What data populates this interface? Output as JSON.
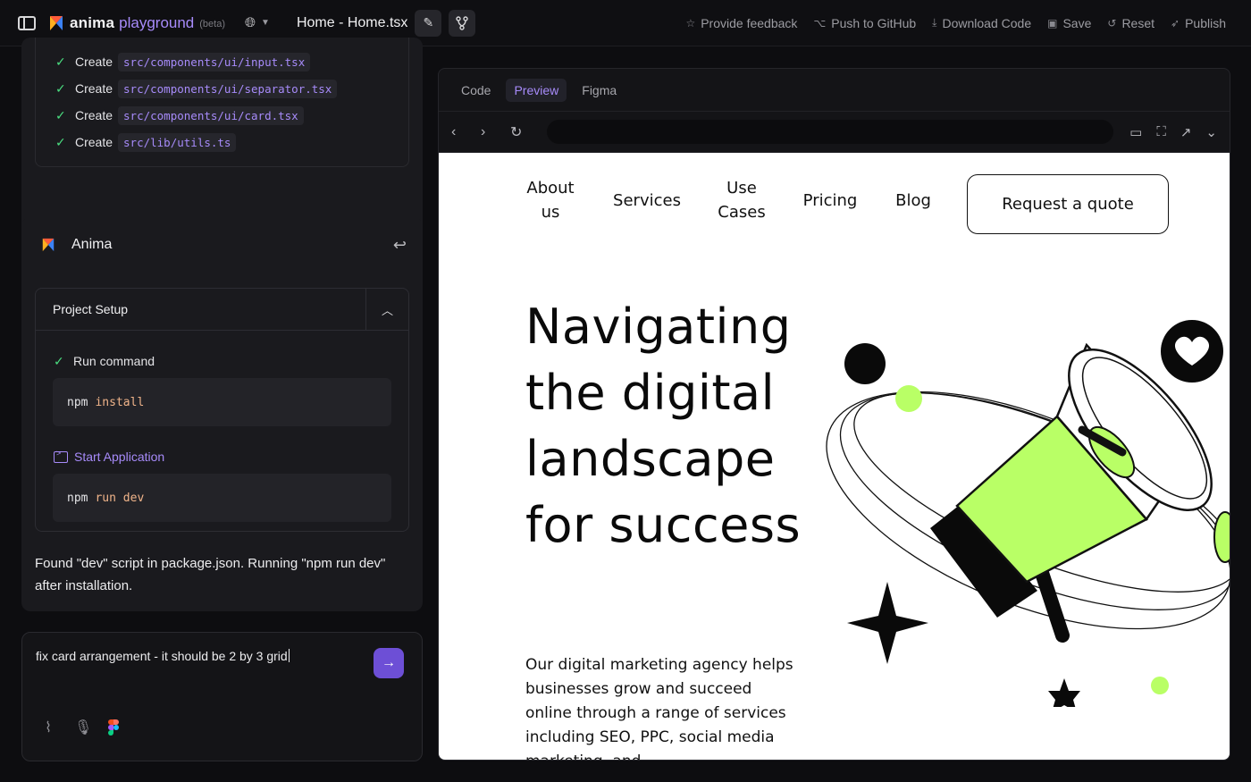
{
  "topbar": {
    "brand": "anima",
    "brand_sub": "playground",
    "beta": "(beta)",
    "file_title": "Home - Home.tsx",
    "actions": [
      {
        "icon": "star-icon",
        "label": "Provide feedback"
      },
      {
        "icon": "github-icon",
        "label": "Push to GitHub"
      },
      {
        "icon": "download-icon",
        "label": "Download Code"
      },
      {
        "icon": "save-icon",
        "label": "Save"
      },
      {
        "icon": "reset-icon",
        "label": "Reset"
      },
      {
        "icon": "rocket-icon",
        "label": "Publish"
      }
    ]
  },
  "files": {
    "items": [
      {
        "action": "Create",
        "path": "src/components/ui/input.tsx"
      },
      {
        "action": "Create",
        "path": "src/components/ui/separator.tsx"
      },
      {
        "action": "Create",
        "path": "src/components/ui/card.tsx"
      },
      {
        "action": "Create",
        "path": "src/lib/utils.ts"
      }
    ]
  },
  "anima": {
    "name": "Anima",
    "setup_title": "Project Setup",
    "step1_label": "Run command",
    "step1_cmd_a": "npm",
    "step1_cmd_b": "install",
    "step2_label": "Start Application",
    "step2_cmd_a": "npm",
    "step2_cmd_b": "run dev",
    "found_text": "Found \"dev\" script in package.json. Running \"npm run dev\" after installation."
  },
  "prompt": {
    "text": "fix card arrangement - it should be 2 by 3 grid"
  },
  "preview_tabs": [
    "Code",
    "Preview",
    "Figma"
  ],
  "active_tab": "Preview",
  "site": {
    "nav": [
      "About us",
      "Services",
      "Use Cases",
      "Pricing",
      "Blog"
    ],
    "cta": "Request a quote",
    "hero_title": "Navigating the digital landscape for success",
    "hero_desc": "Our digital marketing agency helps businesses grow and succeed online through a range of services including SEO, PPC, social media marketing, and"
  },
  "colors": {
    "accent": "#a78bfa",
    "send": "#6d4fd6",
    "lime": "#b9ff66",
    "check": "#4ade80"
  }
}
